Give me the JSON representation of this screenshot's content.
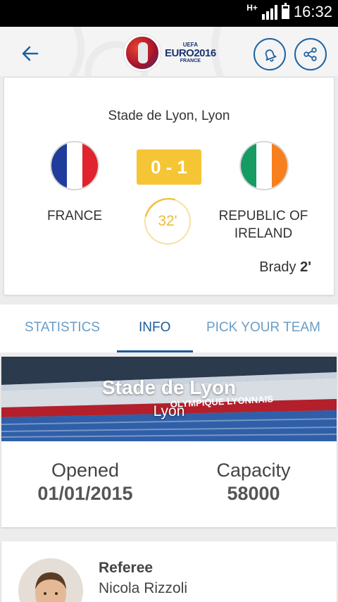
{
  "status_bar": {
    "network": "H+",
    "time": "16:32"
  },
  "header": {
    "logo": {
      "uefa": "UEFA",
      "euro": "EURO2016",
      "country": "FRANCE"
    }
  },
  "match": {
    "venue": "Stade de Lyon, Lyon",
    "home_team": "FRANCE",
    "away_team_line1": "REPUBLIC OF",
    "away_team_line2": "IRELAND",
    "score": "0 - 1",
    "minute": "32'",
    "scorer_name": "Brady",
    "scorer_minute": "2'",
    "colors": {
      "score_bg": "#f5c536",
      "minute": "#f1bb2f"
    }
  },
  "tabs": [
    {
      "label": "STATISTICS",
      "active": false
    },
    {
      "label": "INFO",
      "active": true
    },
    {
      "label": "PICK YOUR TEAM",
      "active": false
    }
  ],
  "stadium": {
    "name": "Stade de Lyon",
    "city": "Lyon",
    "banner_text": "OLYMPIQUE LYONNAIS",
    "opened_label": "Opened",
    "opened_value": "01/01/2015",
    "capacity_label": "Capacity",
    "capacity_value": "58000"
  },
  "referee": {
    "role": "Referee",
    "name": "Nicola Rizzoli"
  },
  "icons": [
    "signal-icon",
    "battery-icon",
    "back-arrow-icon",
    "bell-icon",
    "share-icon"
  ],
  "theme": {
    "accent": "#1c5b9a",
    "accent_light": "#6a9dc6"
  }
}
